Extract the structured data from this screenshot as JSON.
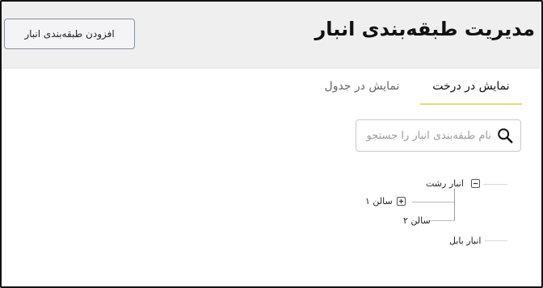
{
  "header": {
    "title": "مدیریت طبقه‌بندی انبار",
    "add_button_label": "افزودن طبقه‌بندی انبار"
  },
  "tabs": [
    {
      "label": "نمایش در درخت",
      "active": true
    },
    {
      "label": "نمایش در جدول",
      "active": false
    }
  ],
  "search": {
    "value": "",
    "placeholder": "نام طبقه‌بندی انبار را جستجو"
  },
  "tree": {
    "nodes": [
      {
        "label": "انبار رشت",
        "toggle": "collapse",
        "children": [
          {
            "label": "سالن ۱",
            "toggle": "expand"
          },
          {
            "label": "سالن ۲",
            "toggle": "none"
          }
        ]
      },
      {
        "label": "انبار بابل",
        "toggle": "none",
        "children": []
      }
    ]
  },
  "colors": {
    "header_bg": "#efefef",
    "active_tab_underline": "#e5d97a",
    "text": "#111111"
  }
}
